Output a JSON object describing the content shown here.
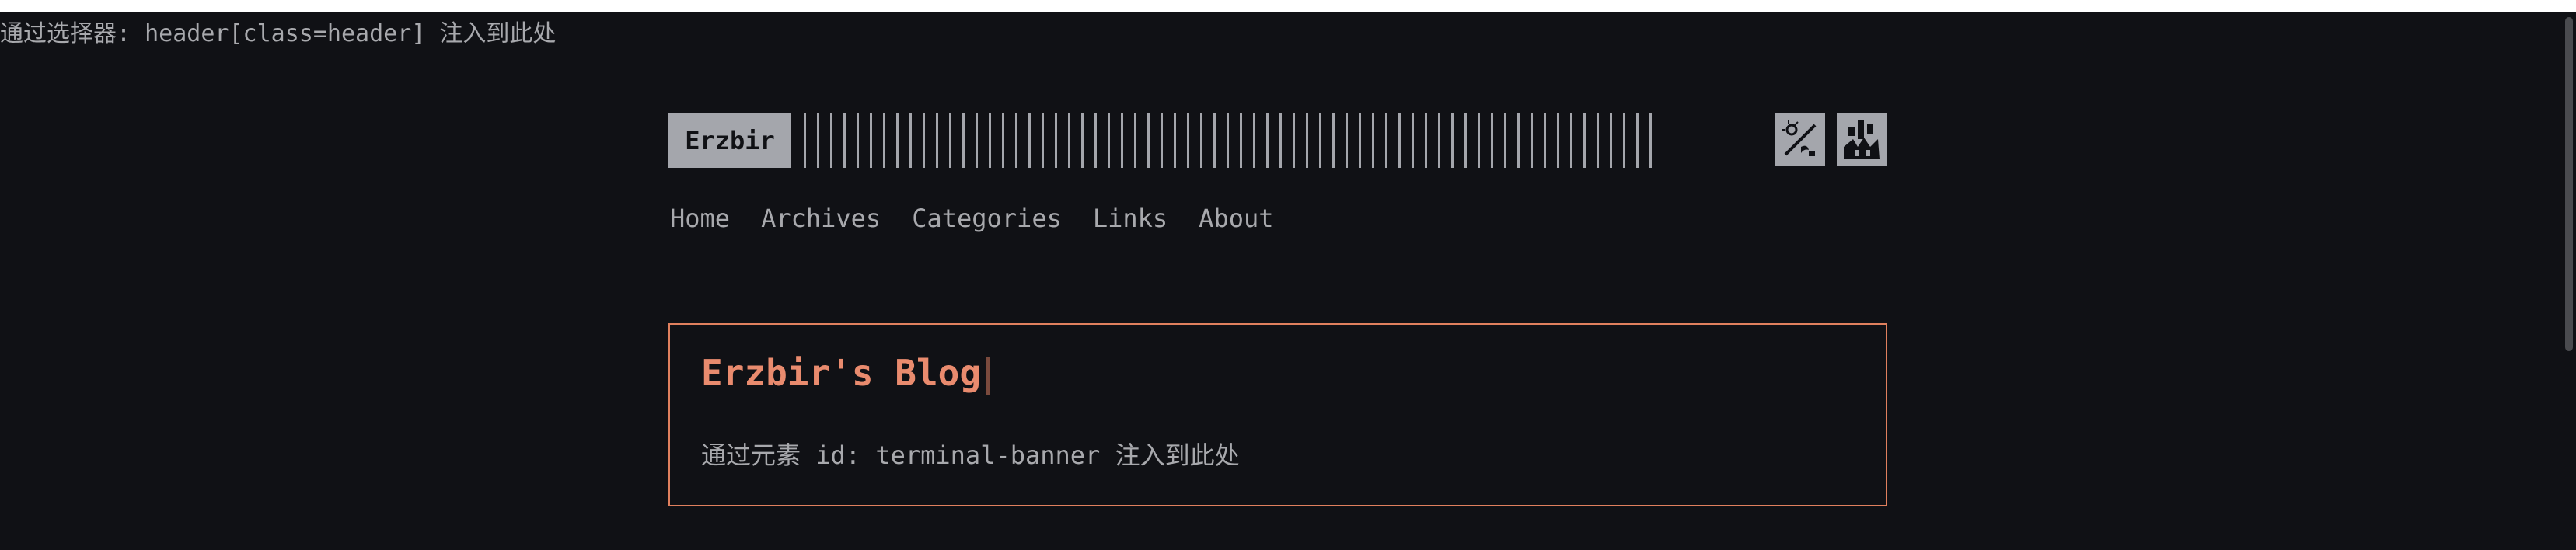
{
  "inject_header_text": "通过选择器: header[class=header] 注入到此处",
  "header": {
    "logo": "Erzbir",
    "theme_icon": "theme-toggle-icon",
    "lang_icon": "language-icon"
  },
  "nav": {
    "items": [
      "Home",
      "Archives",
      "Categories",
      "Links",
      "About"
    ]
  },
  "banner": {
    "title": "Erzbir's Blog",
    "note": "通过元素 id: terminal-banner 注入到此处"
  },
  "colors": {
    "background": "#101115",
    "text": "#a8a9ad",
    "accent": "#e98b6e",
    "logo_bg": "#a4a6ac"
  }
}
